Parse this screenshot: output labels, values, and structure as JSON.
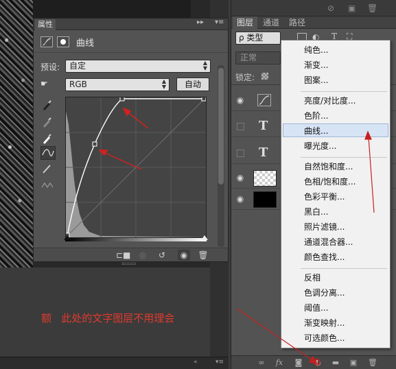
{
  "note": "额   此处的文字图层不用理会",
  "properties": {
    "tab_label": "属性",
    "title": "曲线",
    "preset_label": "预设:",
    "preset_value": "自定",
    "channel_value": "RGB",
    "auto_label": "自动"
  },
  "layers": {
    "tabs": [
      "图层",
      "通道",
      "路径"
    ],
    "kind_label": "ρ 类型",
    "blend_mode": "正常",
    "lock_label": "锁定:",
    "text_layer_glyph": "T"
  },
  "menu": {
    "items": [
      "纯色...",
      "渐变...",
      "图案...",
      "亮度/对比度...",
      "色阶...",
      "曲线...",
      "曝光度...",
      "自然饱和度...",
      "色相/饱和度...",
      "色彩平衡...",
      "黑白...",
      "照片滤镜...",
      "通道混合器...",
      "颜色查找...",
      "反相",
      "色调分离...",
      "阈值...",
      "渐变映射...",
      "可选颜色..."
    ],
    "highlighted": "曲线..."
  },
  "colors": {
    "annotation_red": "#e03a2e",
    "menu_highlight": "#d7e4f5",
    "panel_bg": "#535353"
  },
  "icons": {
    "eye": "eye-icon",
    "text": "text-layer-icon",
    "link": "link-icon",
    "fx": "fx-icon",
    "mask": "mask-icon",
    "adjustment": "adjustment-layer-icon",
    "folder": "folder-icon",
    "new_layer": "new-layer-icon",
    "trash": "trash-icon"
  }
}
